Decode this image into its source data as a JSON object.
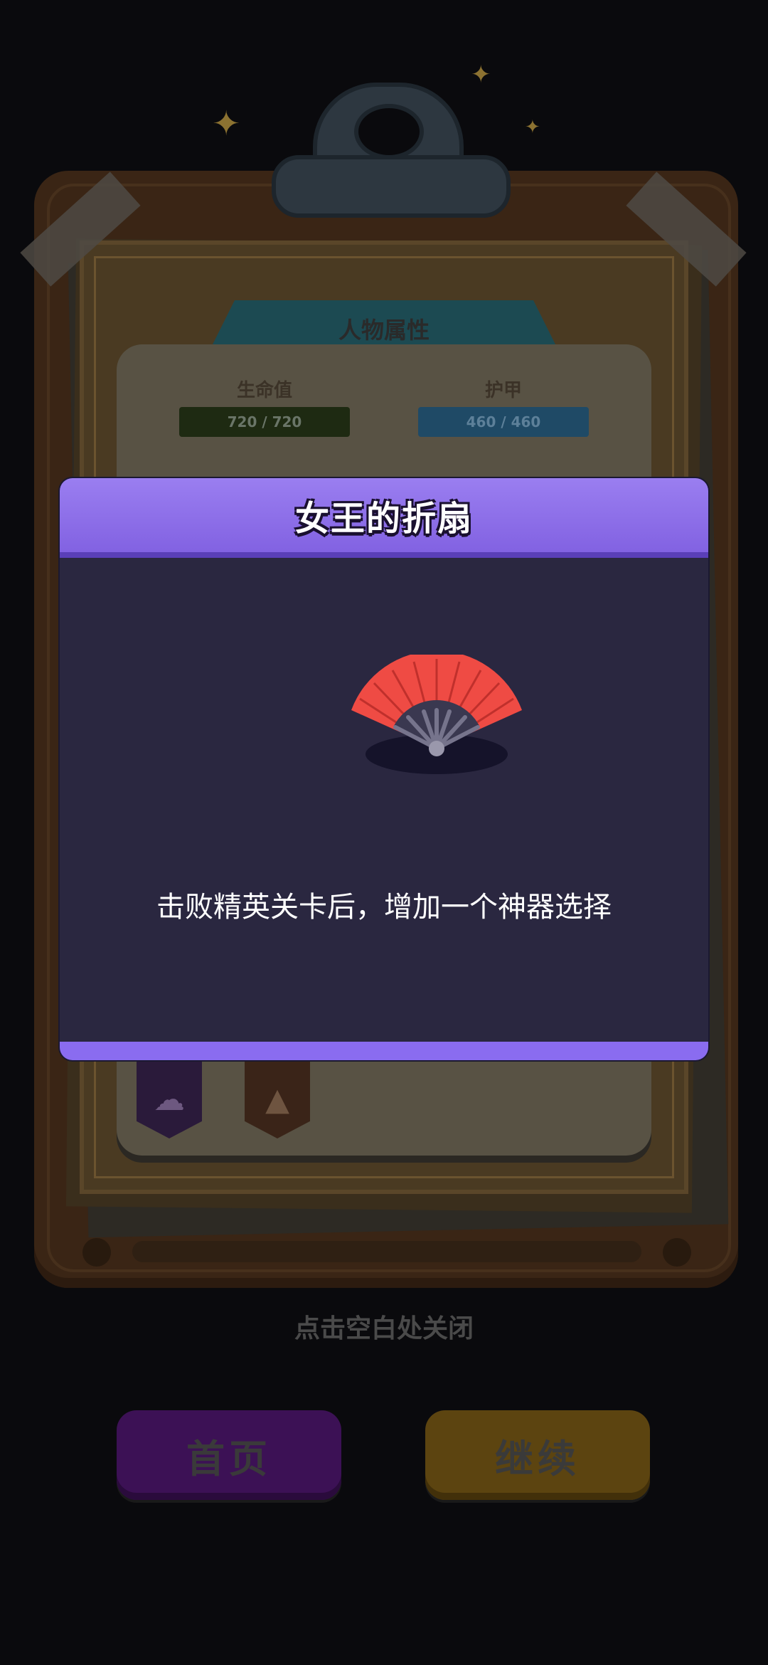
{
  "character_sheet": {
    "section_title": "人物属性",
    "health": {
      "label": "生命值",
      "value_text": "720 / 720"
    },
    "armor": {
      "label": "护甲",
      "value_text": "460 / 460"
    }
  },
  "artifact_popup": {
    "title": "女王的折扇",
    "description": "击败精英关卡后，增加一个神器选择",
    "icon": "folding-fan-icon",
    "colors": {
      "header": "#8a6cf0",
      "body": "#2a2740",
      "fan": "#ef4b44"
    }
  },
  "close_hint": "点击空白处关闭",
  "buttons": {
    "home": "首页",
    "continue": "继续"
  }
}
